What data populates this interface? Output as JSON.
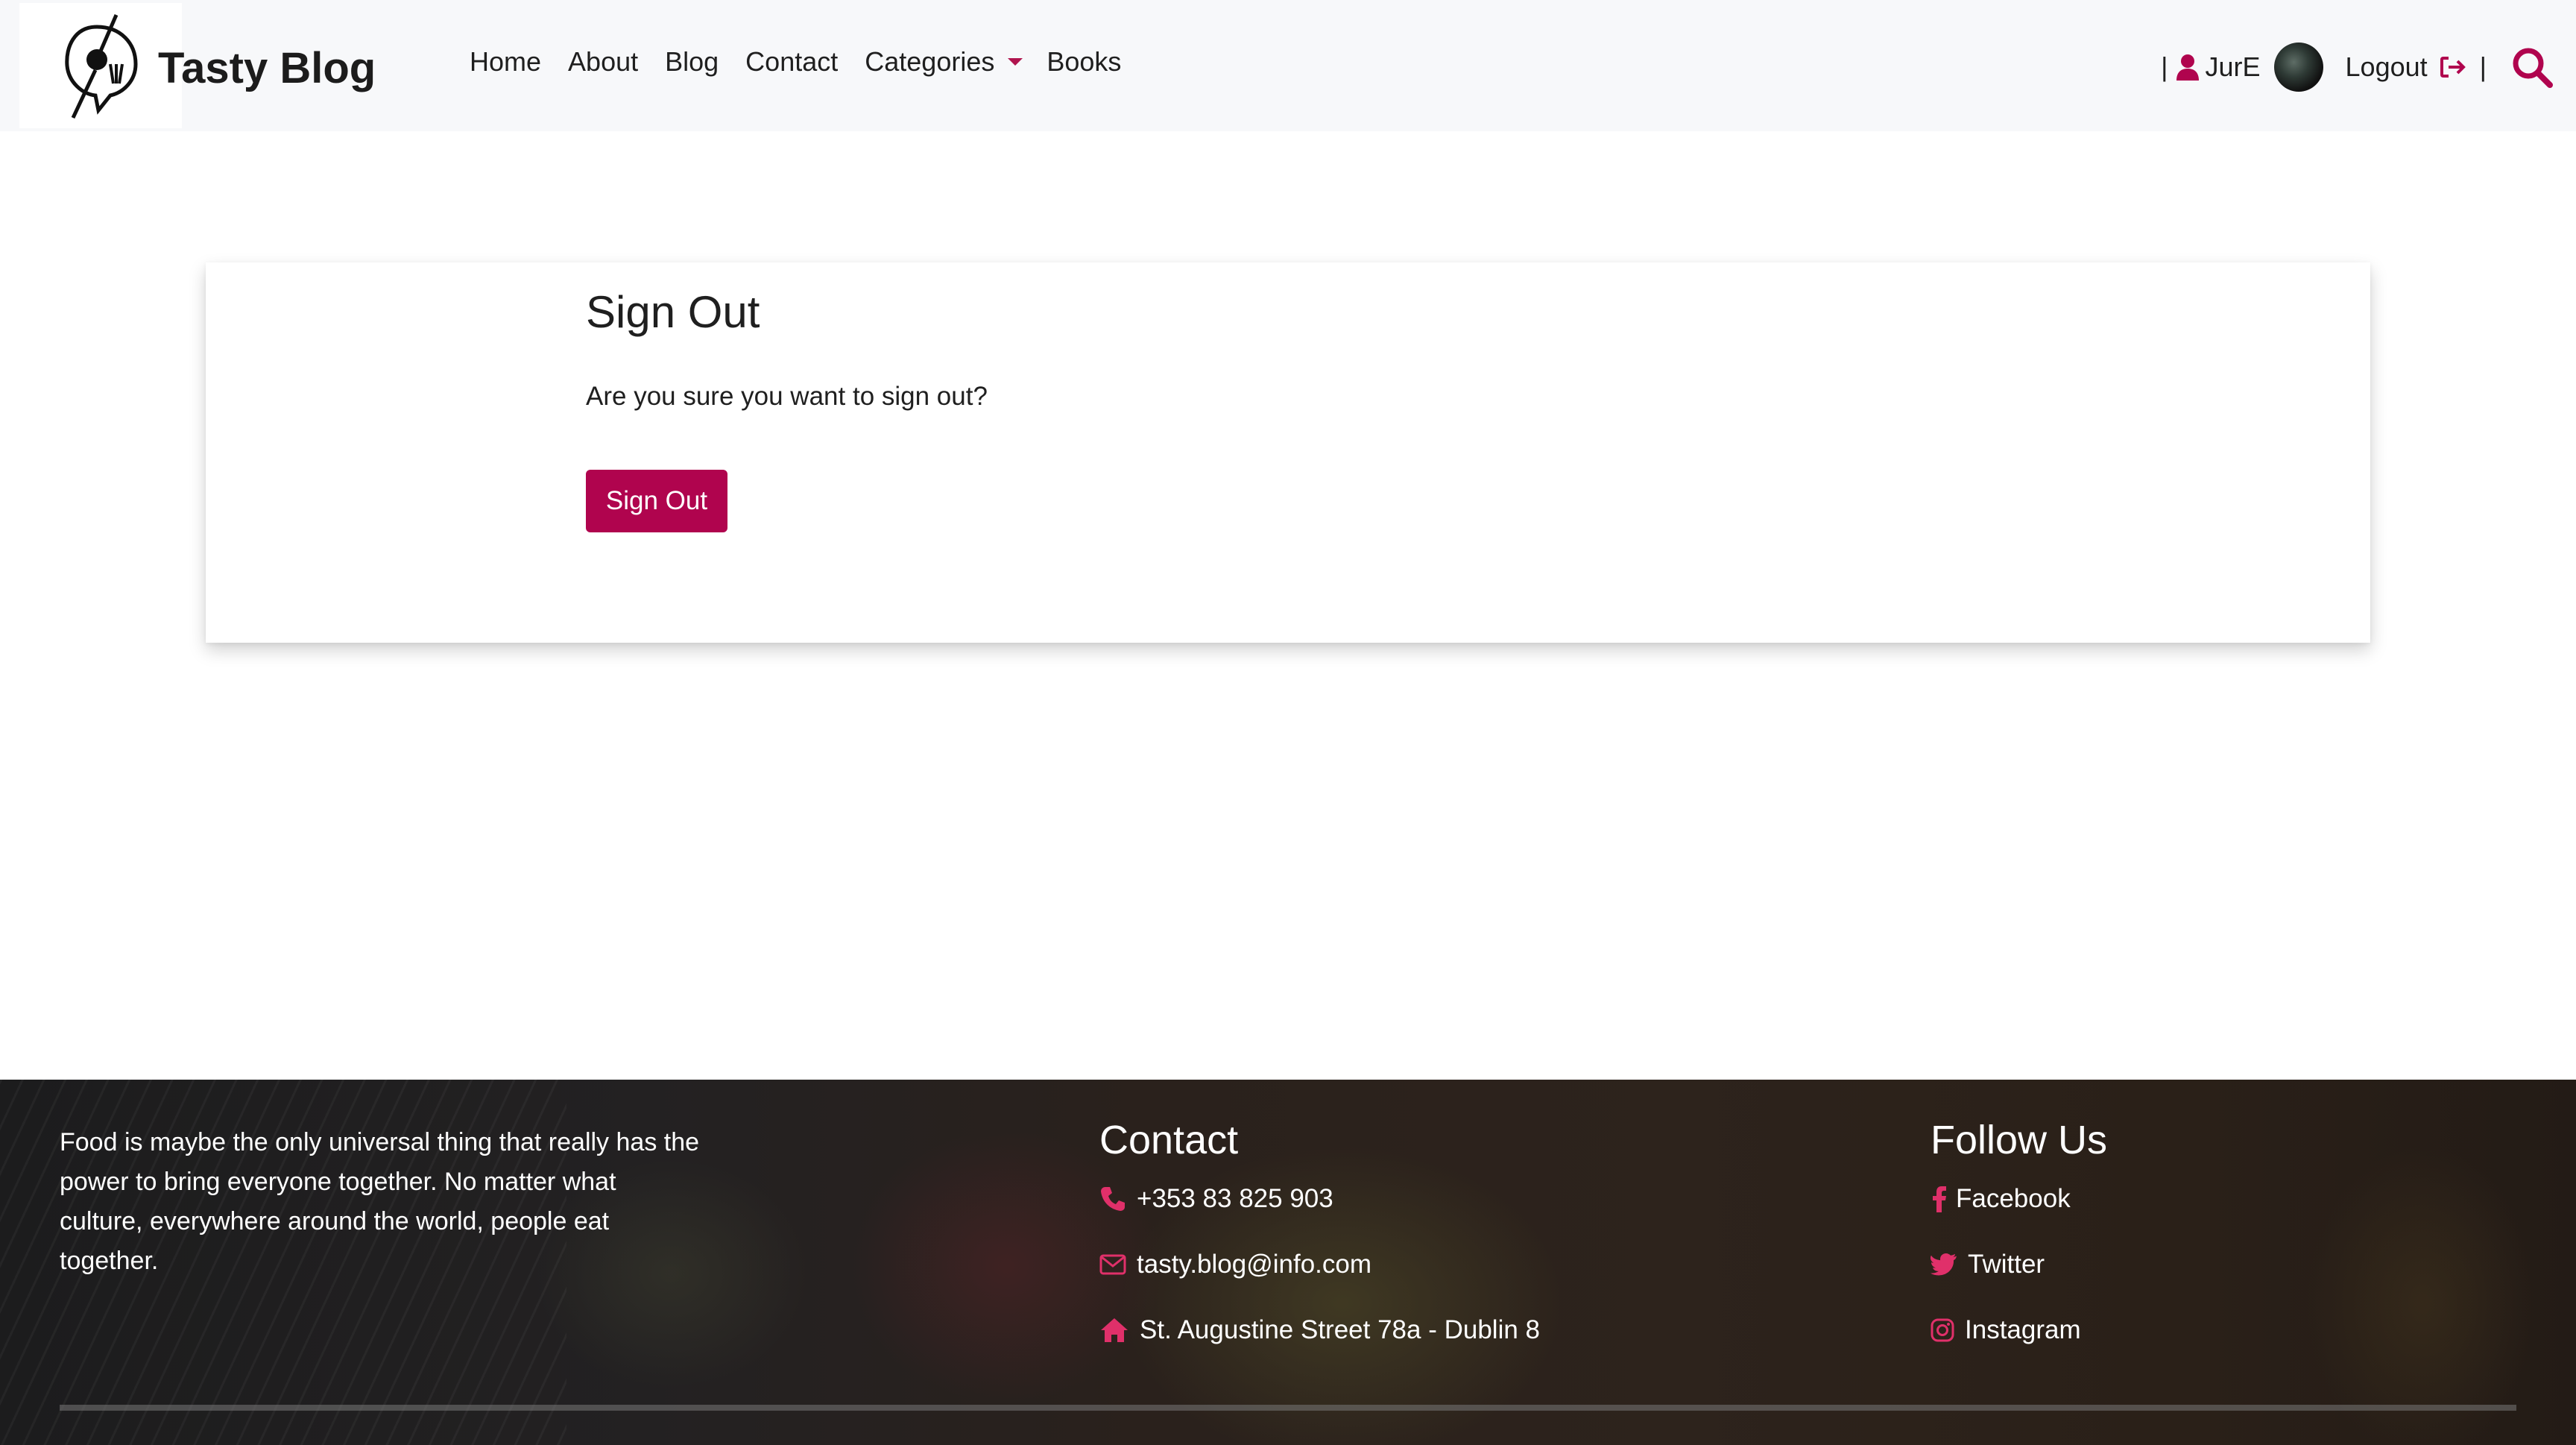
{
  "brand": {
    "title": "Tasty Blog"
  },
  "nav": {
    "items": [
      {
        "label": "Home"
      },
      {
        "label": "About"
      },
      {
        "label": "Blog"
      },
      {
        "label": "Contact"
      },
      {
        "label": "Categories"
      },
      {
        "label": "Books"
      }
    ],
    "user": {
      "separator": "|",
      "username": "JurE",
      "logout_label": "Logout"
    }
  },
  "main": {
    "title": "Sign Out",
    "prompt": "Are you sure you want to sign out?",
    "button_label": "Sign Out"
  },
  "footer": {
    "about": "Food is maybe the only universal thing that really has the power to bring everyone together. No matter what culture, everywhere around the world, people eat together.",
    "contact": {
      "heading": "Contact",
      "phone": "+353 83 825 903",
      "email": "tasty.blog@info.com",
      "address": "St. Augustine Street 78a - Dublin 8"
    },
    "social": {
      "heading": "Follow Us",
      "facebook": "Facebook",
      "twitter": "Twitter",
      "instagram": "Instagram"
    }
  },
  "colors": {
    "accent": "#b0044e",
    "navbar_bg": "#f7f8fa",
    "footer_bg": "#231f1d"
  },
  "icons": [
    "logo-icon",
    "user-icon",
    "avatar",
    "logout-icon",
    "search-icon",
    "caret-down-icon",
    "phone-icon",
    "envelope-icon",
    "home-icon",
    "facebook-icon",
    "twitter-icon",
    "instagram-icon"
  ]
}
